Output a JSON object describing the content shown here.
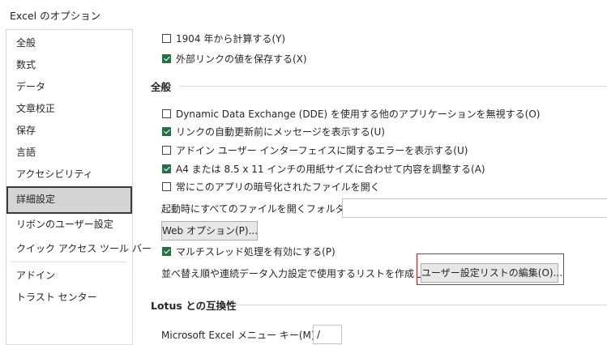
{
  "window": {
    "title": "Excel のオプション"
  },
  "sidebar": {
    "items": [
      {
        "label": "全般"
      },
      {
        "label": "数式"
      },
      {
        "label": "データ"
      },
      {
        "label": "文章校正"
      },
      {
        "label": "保存"
      },
      {
        "label": "言語"
      },
      {
        "label": "アクセシビリティ"
      },
      {
        "label": "詳細設定"
      },
      {
        "label": "リボンのユーザー設定"
      },
      {
        "label": "クイック アクセス ツール バー"
      },
      {
        "label": "アドイン"
      },
      {
        "label": "トラスト センター"
      }
    ],
    "selected": "詳細設定"
  },
  "main": {
    "top_options": [
      {
        "label": "1904 年から計算する(Y)",
        "checked": false
      },
      {
        "label": "外部リンクの値を保存する(X)",
        "checked": true
      }
    ],
    "general": {
      "heading": "全般",
      "options": [
        {
          "label": "Dynamic Data Exchange (DDE) を使用する他のアプリケーションを無視する(O)",
          "checked": false
        },
        {
          "label": "リンクの自動更新前にメッセージを表示する(U)",
          "checked": true
        },
        {
          "label": "アドイン ユーザー インターフェイスに関するエラーを表示する(U)",
          "checked": false
        },
        {
          "label": "A4 または 8.5 x 11 インチの用紙サイズに合わせて内容を調整する(A)",
          "checked": true
        },
        {
          "label": "常にこのアプリの暗号化されたファイルを開く",
          "checked": false
        }
      ],
      "startup_label": "起動時にすべてのファイルを開くフォルダー(L):",
      "startup_value": "",
      "web_options_button": "Web オプション(P)...",
      "multithread_label": "マルチスレッド処理を有効にする(P)",
      "multithread_checked": true,
      "custom_list_label": "並べ替え順や連続データ入力設定で使用するリストを作成します:",
      "custom_list_button": "ユーザー設定リストの編集(O)..."
    },
    "lotus": {
      "heading": "Lotus との互換性",
      "menu_key_label": "Microsoft Excel メニュー キー(M):",
      "menu_key_value": "/"
    }
  },
  "colors": {
    "check_green": "#217346",
    "highlight_red": "#e21b1b"
  }
}
